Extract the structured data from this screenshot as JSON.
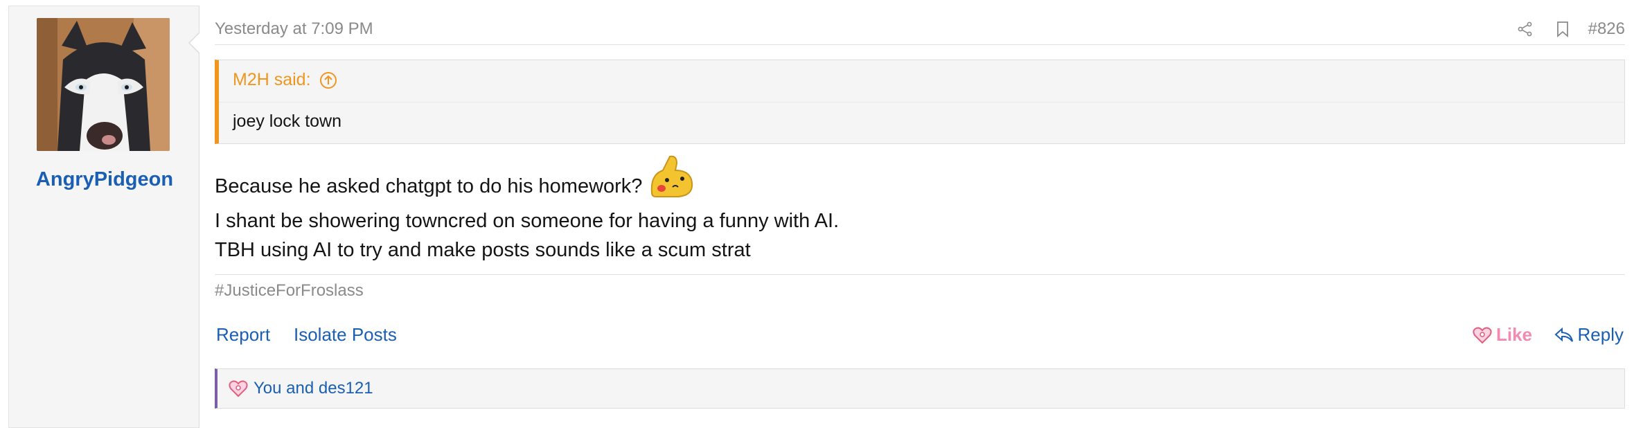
{
  "user": {
    "name": "AngryPidgeon",
    "avatar_icon": "husky-dog-avatar"
  },
  "post": {
    "timestamp": "Yesterday at 7:09 PM",
    "number": "#826",
    "quote": {
      "author": "M2H said:",
      "text": "joey lock town"
    },
    "lines": [
      "Because he asked chatgpt to do his homework?",
      "I shant be showering towncred on someone for having a funny with AI.",
      "TBH using AI to try and make posts sounds like a scum strat"
    ],
    "signature": "#JusticeForFroslass"
  },
  "actions": {
    "report": "Report",
    "isolate": "Isolate Posts",
    "like": "Like",
    "reply": "Reply"
  },
  "reactions": {
    "text": "You and des121"
  },
  "colors": {
    "link": "#1a5fb4",
    "quote_accent": "#f0961e",
    "like": "#f28ab2",
    "reaction_bar": "#7b5ea7"
  }
}
